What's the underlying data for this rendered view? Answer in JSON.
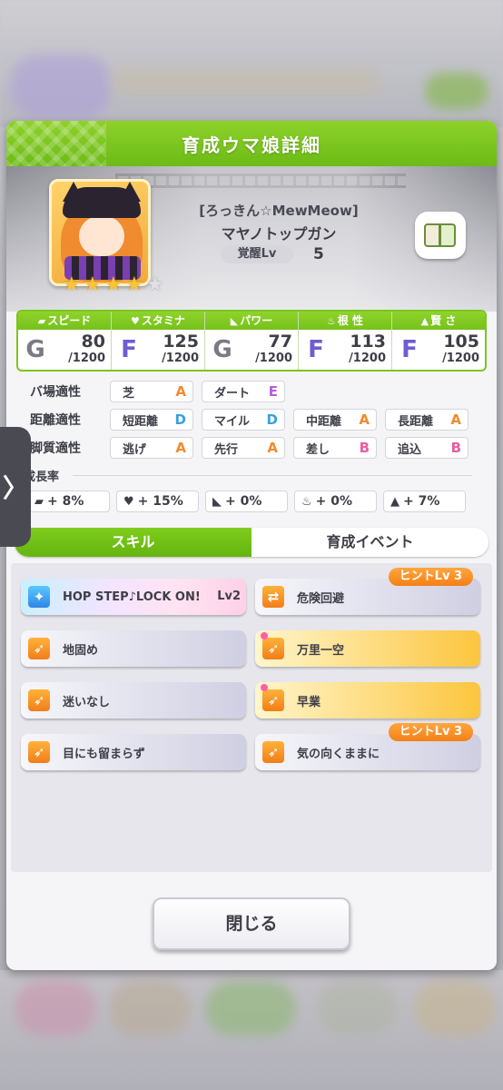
{
  "modal": {
    "title": "育成ウマ娘詳細"
  },
  "character": {
    "card_title": "[ろっきん☆MewMeow]",
    "name": "マヤノトップガン",
    "awakening_label": "覚醒Lv",
    "awakening_level": "5",
    "stars_filled": 4,
    "stars_total": 5
  },
  "stats": [
    {
      "icon": "shoe-icon",
      "label": "スピード",
      "rank": "G",
      "value": "80",
      "max": "/1200"
    },
    {
      "icon": "heart-icon",
      "label": "スタミナ",
      "rank": "F",
      "value": "125",
      "max": "/1200"
    },
    {
      "icon": "muscle-icon",
      "label": "パワー",
      "rank": "G",
      "value": "77",
      "max": "/1200"
    },
    {
      "icon": "flame-icon",
      "label": "根 性",
      "rank": "F",
      "value": "113",
      "max": "/1200"
    },
    {
      "icon": "graduation-cap-icon",
      "label": "賢 さ",
      "rank": "F",
      "value": "105",
      "max": "/1200"
    }
  ],
  "aptitudes": {
    "track": {
      "label": "バ場適性",
      "items": [
        {
          "name": "芝",
          "grade": "A"
        },
        {
          "name": "ダート",
          "grade": "E"
        }
      ]
    },
    "distance": {
      "label": "距離適性",
      "items": [
        {
          "name": "短距離",
          "grade": "D"
        },
        {
          "name": "マイル",
          "grade": "D"
        },
        {
          "name": "中距離",
          "grade": "A"
        },
        {
          "name": "長距離",
          "grade": "A"
        }
      ]
    },
    "style": {
      "label": "脚質適性",
      "items": [
        {
          "name": "逃げ",
          "grade": "A"
        },
        {
          "name": "先行",
          "grade": "A"
        },
        {
          "name": "差し",
          "grade": "B"
        },
        {
          "name": "追込",
          "grade": "B"
        }
      ]
    }
  },
  "growth": {
    "title": "成長率",
    "items": [
      {
        "icon": "shoe-icon",
        "value": "+ 8%"
      },
      {
        "icon": "heart-icon",
        "value": "+ 15%"
      },
      {
        "icon": "muscle-icon",
        "value": "+ 0%"
      },
      {
        "icon": "flame-icon",
        "value": "+ 0%"
      },
      {
        "icon": "graduation-cap-icon",
        "value": "+ 7%"
      }
    ]
  },
  "tabs": [
    {
      "label": "スキル",
      "active": true
    },
    {
      "label": "育成イベント",
      "active": false
    }
  ],
  "skills": [
    {
      "name": "HOP STEP♪LOCK ON!",
      "level": "Lv2",
      "style": "rainbow",
      "hint": "",
      "new": false
    },
    {
      "name": "危険回避",
      "level": "",
      "style": "normal",
      "hint": "ヒントLv 3",
      "new": false
    },
    {
      "name": "地固め",
      "level": "",
      "style": "normal",
      "hint": "",
      "new": false
    },
    {
      "name": "万里一空",
      "level": "",
      "style": "gold",
      "hint": "",
      "new": true
    },
    {
      "name": "迷いなし",
      "level": "",
      "style": "normal",
      "hint": "",
      "new": false
    },
    {
      "name": "早業",
      "level": "",
      "style": "gold",
      "hint": "",
      "new": true
    },
    {
      "name": "目にも留まらず",
      "level": "",
      "style": "normal",
      "hint": "",
      "new": false
    },
    {
      "name": "気の向くままに",
      "level": "",
      "style": "normal",
      "hint": "ヒントLv 3",
      "new": false
    }
  ],
  "close_button": {
    "label": "閉じる"
  },
  "side_tab": {
    "glyph": "〉"
  },
  "colors": {
    "accent_green": "#7cc51f",
    "hint_orange": "#f57f15",
    "rank_F": "#6f5bd3",
    "rank_G": "#7a7a86"
  }
}
